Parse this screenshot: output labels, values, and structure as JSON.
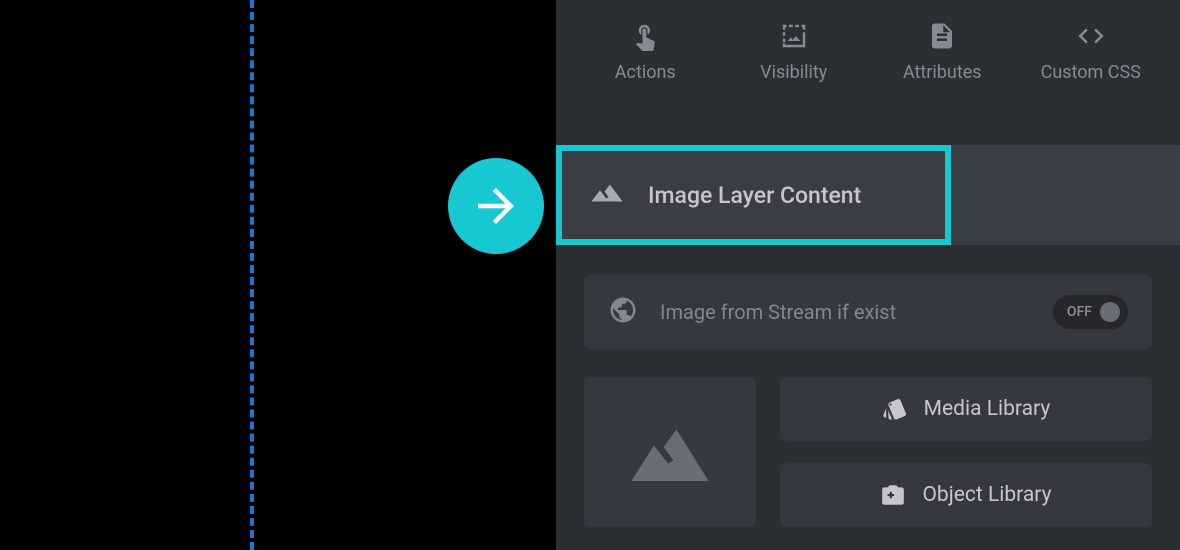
{
  "tabs": {
    "actions": "Actions",
    "visibility": "Visibility",
    "attributes": "Attributes",
    "custom_css": "Custom CSS"
  },
  "section": {
    "title": "Image Layer Content"
  },
  "stream_row": {
    "label": "Image from Stream if exist",
    "toggle_label": "OFF"
  },
  "buttons": {
    "media_library": "Media Library",
    "object_library": "Object Library"
  }
}
